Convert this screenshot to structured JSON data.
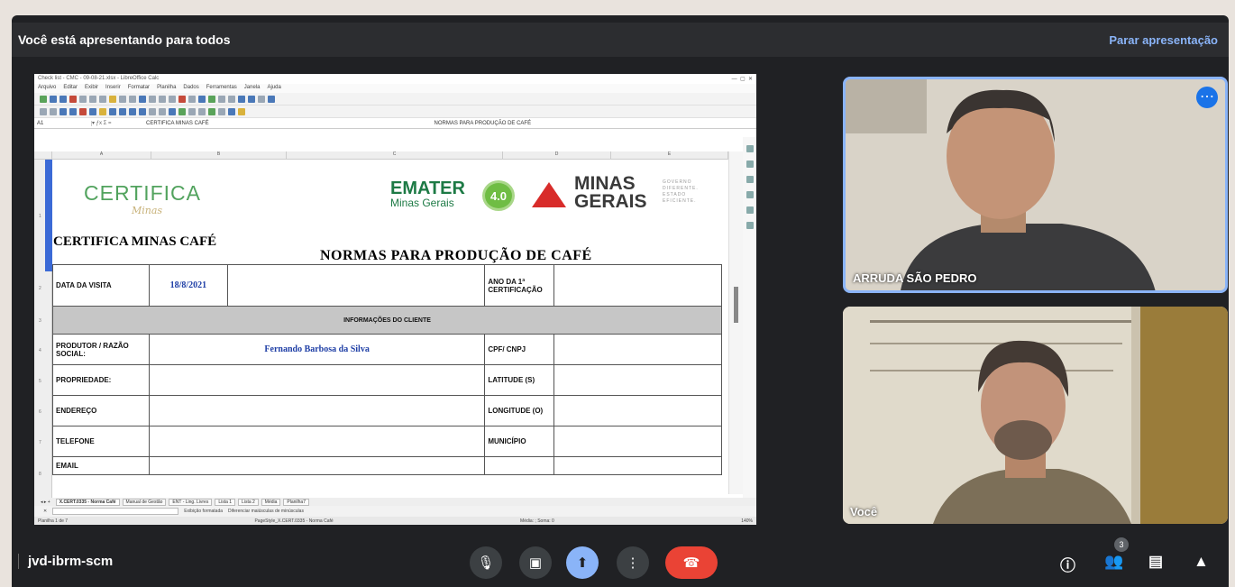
{
  "banner": {
    "text": "Você está apresentando para todos",
    "stop": "Parar apresentação"
  },
  "sheet": {
    "window_title": "Check list - CMC - 09-08-21.xlsx - LibreOffice Calc",
    "menu": [
      "Arquivo",
      "Editar",
      "Exibir",
      "Inserir",
      "Formatar",
      "Planilha",
      "Dados",
      "Ferramentas",
      "Janela",
      "Ajuda"
    ],
    "cell_ref": "A1",
    "formula": "CERTIFICA MINAS CAFÉ",
    "formula_right": "NORMAS PARA PRODUÇÃO DE CAFÉ",
    "logos": {
      "certifica": "CERTIFICA",
      "certifica_sub": "Minas",
      "emater": "EMATER",
      "emater_sub": "Minas Gerais",
      "badge": "4.0",
      "mg": "MINAS GERAIS",
      "mg_sub": "GOVERNO DIFERENTE. ESTADO EFICIENTE."
    },
    "title_left": "CERTIFICA MINAS CAFÉ",
    "title_right": "NORMAS PARA PRODUÇÃO DE CAFÉ",
    "row_visit": {
      "label": "DATA DA VISITA",
      "date": "18/8/2021",
      "cert_label": "ANO DA 1ª CERTIFICAÇÃO"
    },
    "section": "INFORMAÇÕES DO CLIENTE",
    "rows": [
      {
        "label": "PRODUTOR  /  RAZÃO SOCIAL:",
        "value": "Fernando Barbosa da Silva",
        "right": "CPF/ CNPJ"
      },
      {
        "label": "PROPRIEDADE:",
        "value": "",
        "right": "LATITUDE (S)"
      },
      {
        "label": "ENDEREÇO",
        "value": "",
        "right": "LONGITUDE (O)"
      },
      {
        "label": "TELEFONE",
        "value": "",
        "right": "MUNICÍPIO"
      },
      {
        "label": "EMAIL",
        "value": "",
        "right": ""
      }
    ],
    "tabs": [
      "X.CERT.0335 - Norma Café",
      "Manual de Gestão",
      "ENT - Ling. Livres",
      "Lista 1",
      "Lista 2",
      "Média",
      "Planilha7"
    ],
    "find": {
      "opt1": "Diferenciar maiúsculas de minúsculas",
      "opt2": "Exibição formatada"
    },
    "status_left": "Planilha 1 de 7",
    "status_mid": "PageStyle_X.CERT.0335 - Norma Café",
    "status_right": "Média: ; Soma: 0",
    "zoom": "140%"
  },
  "participants": [
    {
      "name": "ARRUDA SÃO PEDRO"
    },
    {
      "name": "Você"
    }
  ],
  "meeting_code": "jvd-ibrm-scm",
  "people_count": "3"
}
